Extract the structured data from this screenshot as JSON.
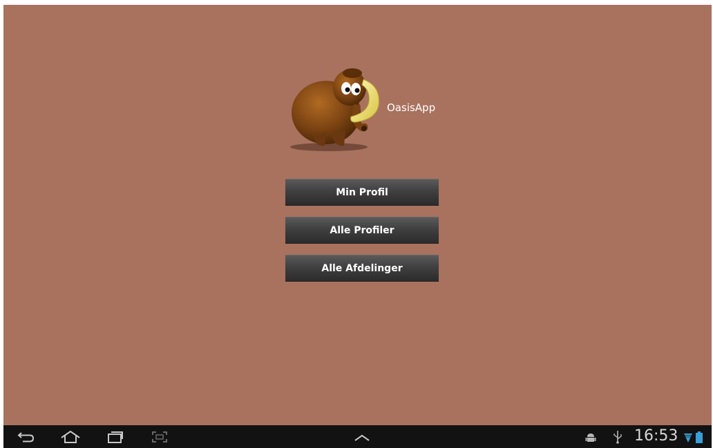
{
  "app": {
    "title": "OasisApp",
    "logo_icon": "mammoth-logo-icon"
  },
  "menu": {
    "buttons": [
      {
        "label": "Min Profil"
      },
      {
        "label": "Alle Profiler"
      },
      {
        "label": "Alle Afdelinger"
      }
    ]
  },
  "system_bar": {
    "time": "16:53",
    "left_icons": [
      "back-icon",
      "home-icon",
      "recent-apps-icon",
      "screenshot-icon"
    ],
    "center_icon": "chevron-up-icon",
    "right_icons": [
      "android-debug-icon",
      "usb-icon",
      "wifi-icon",
      "battery-icon"
    ]
  },
  "colors": {
    "background": "#a8725f",
    "button": "#404040",
    "nav_bar": "#121212"
  }
}
